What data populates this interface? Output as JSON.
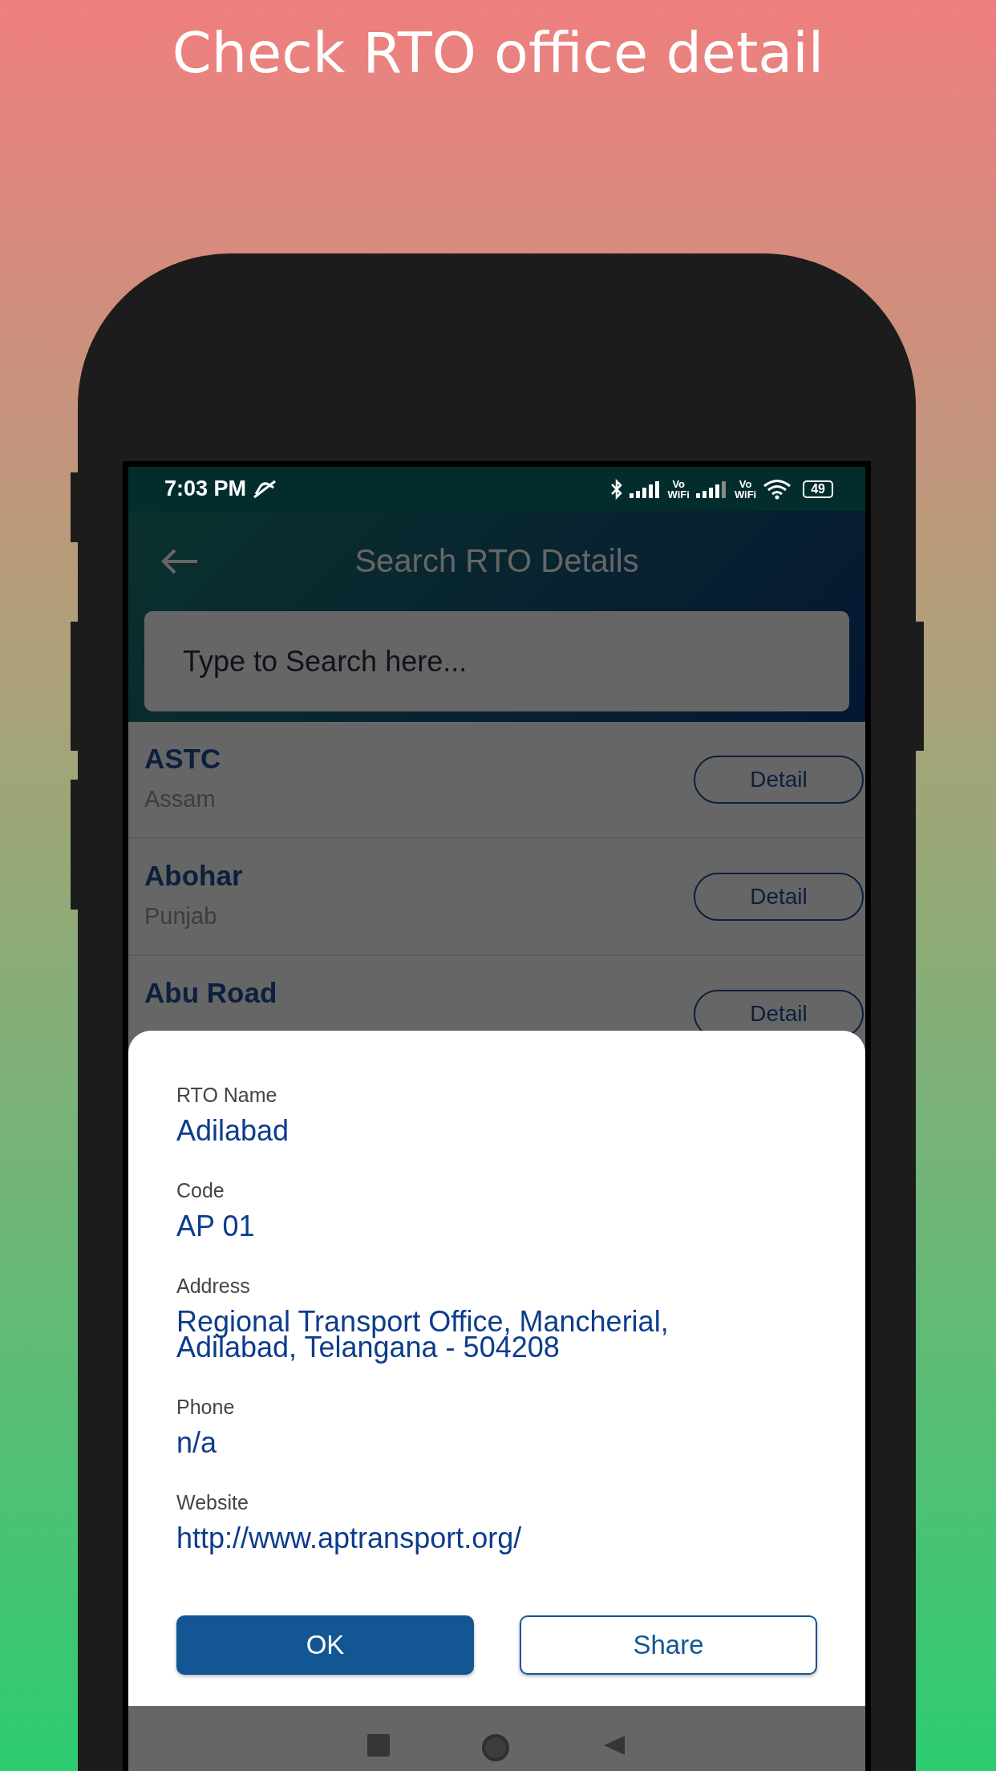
{
  "headline": "Check RTO office detail",
  "status_bar": {
    "time": "7:03 PM",
    "vo_wifi_labels": [
      {
        "top": "Vo",
        "bottom": "WiFi"
      },
      {
        "top": "Vo",
        "bottom": "WiFi"
      }
    ],
    "battery": "49"
  },
  "app_bar": {
    "title": "Search RTO Details"
  },
  "search": {
    "placeholder": "Type to Search here..."
  },
  "rows": [
    {
      "name": "ASTC",
      "state": "Assam",
      "button": "Detail"
    },
    {
      "name": "Abohar",
      "state": "Punjab",
      "button": "Detail"
    },
    {
      "name": "Abu Road",
      "button": "Detail"
    }
  ],
  "dialog": {
    "fields": [
      {
        "label": "RTO Name",
        "value": "Adilabad"
      },
      {
        "label": "Code",
        "value": "AP 01"
      },
      {
        "label": "Address",
        "value": "Regional Transport Office, Mancherial, Adilabad, Telangana - 504208"
      },
      {
        "label": "Phone",
        "value": "n/a"
      },
      {
        "label": "Website",
        "value": "http://www.aptransport.org/"
      }
    ],
    "buttons": [
      {
        "label": "OK",
        "kind": "primary"
      },
      {
        "label": "Share",
        "kind": "outline"
      }
    ]
  }
}
